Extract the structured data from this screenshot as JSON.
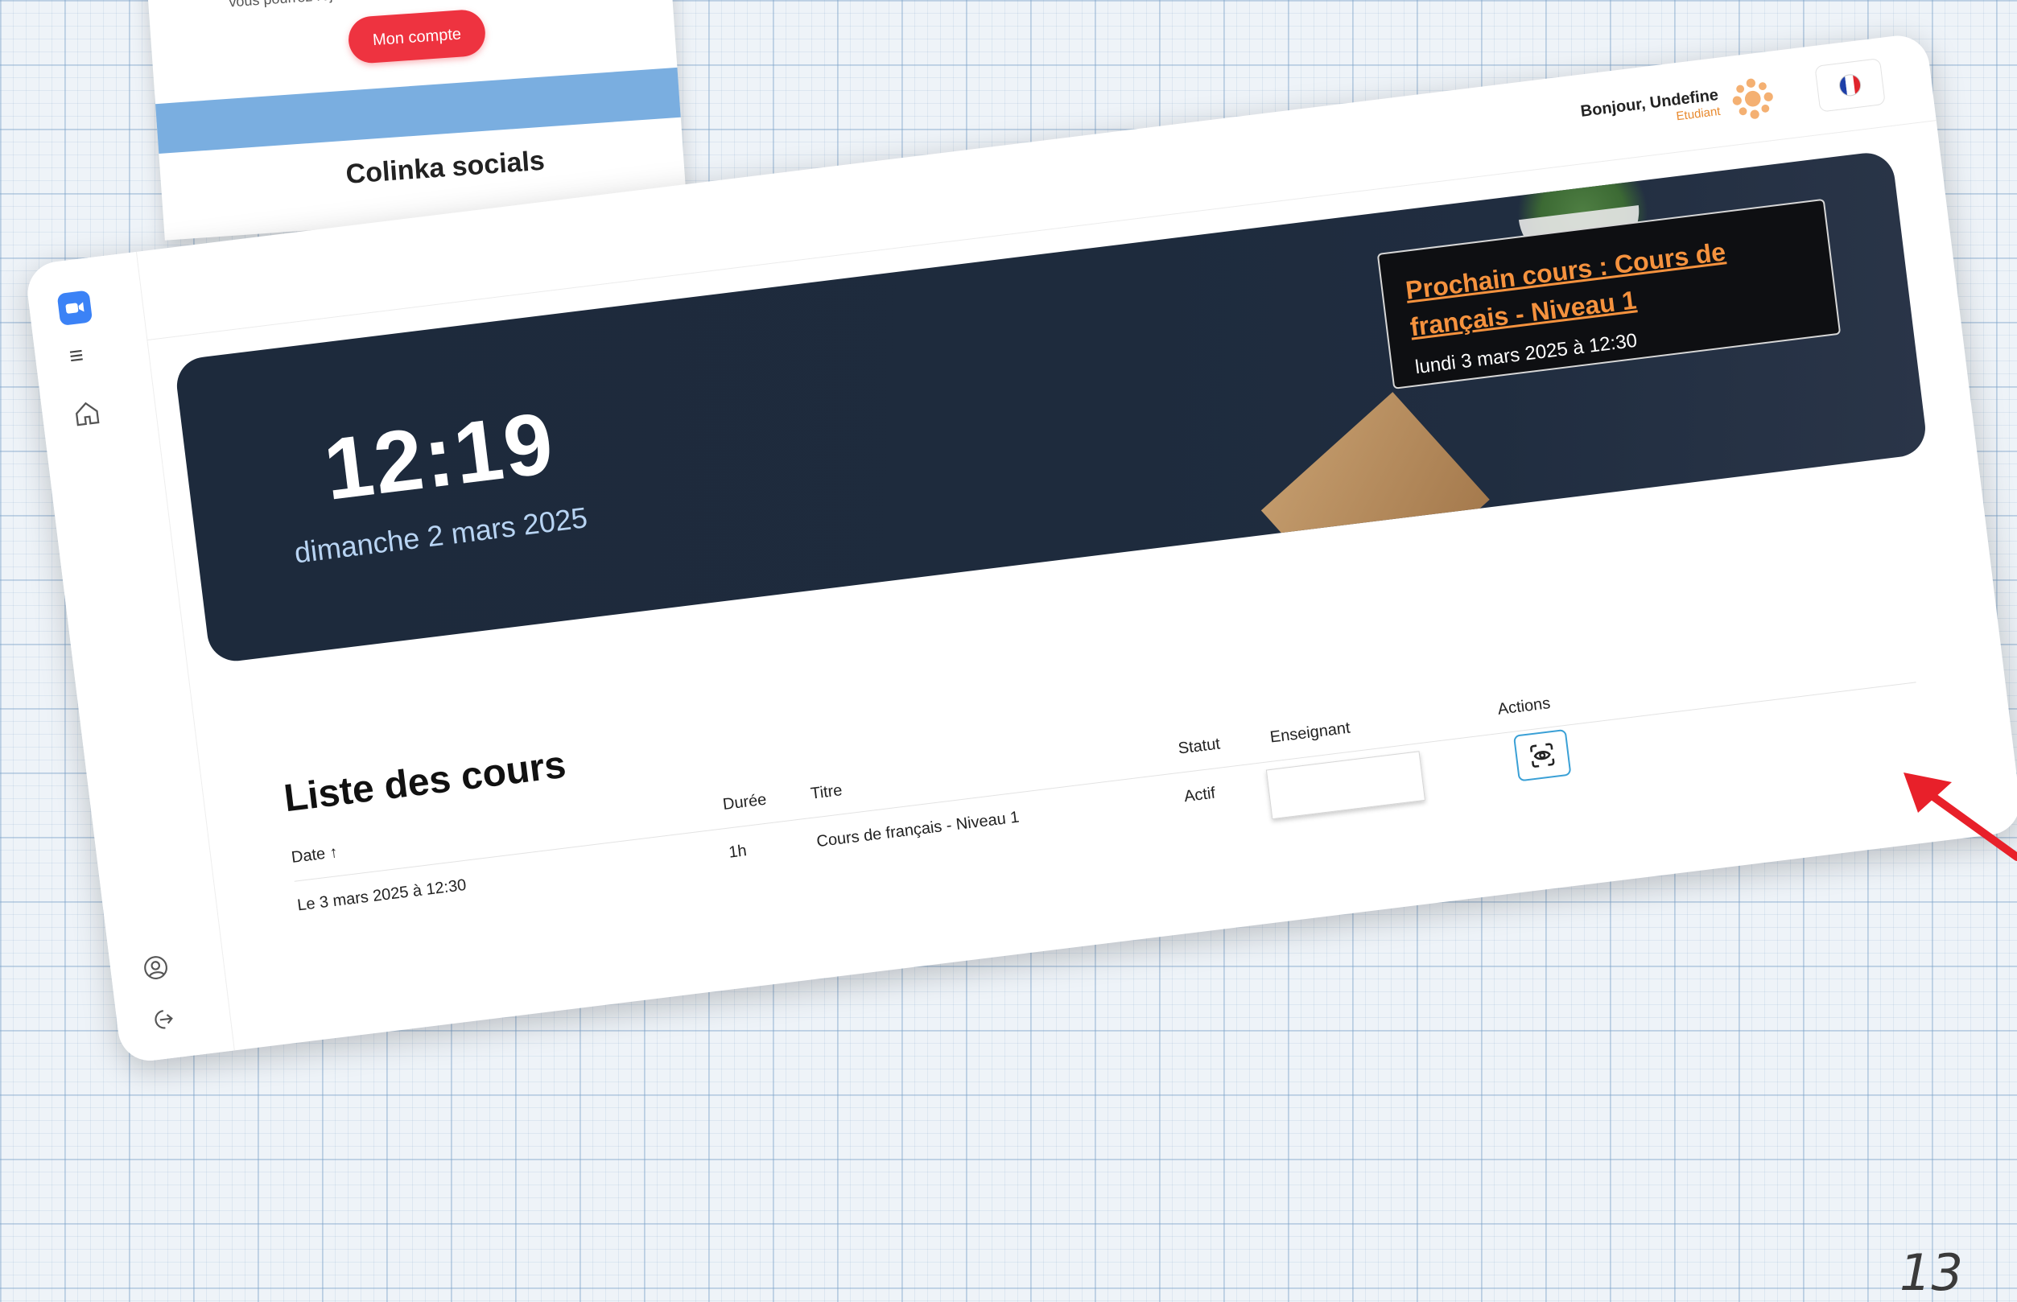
{
  "email_card": {
    "text": "vous pourrez rejoindre le cours",
    "account_button": "Mon compte",
    "socials_title": "Colinka socials"
  },
  "header": {
    "greeting": "Bonjour, Undefine",
    "role": "Etudiant",
    "language_icon": "french-flag-icon"
  },
  "hero": {
    "time": "12:19",
    "date": "dimanche 2 mars 2025",
    "next_course_title": "Prochain cours : Cours de français - Niveau 1",
    "next_course_date": "lundi 3 mars 2025 à 12:30"
  },
  "course_list": {
    "title": "Liste des cours",
    "columns": {
      "date": "Date ↑",
      "duration": "Durée",
      "title": "Titre",
      "status": "Statut",
      "teacher": "Enseignant",
      "actions": "Actions"
    },
    "rows": [
      {
        "date": "Le 3 mars 2025 à 12:30",
        "duration": "1h",
        "title": "Cours de français - Niveau 1",
        "status": "Actif",
        "teacher": ""
      }
    ]
  },
  "page_number": "13",
  "colors": {
    "accent": "#f5923e",
    "hero_bg": "#1d2a3c",
    "button_red": "#ee3340",
    "action_border": "#3aa0d6",
    "arrow": "#e8202a"
  }
}
